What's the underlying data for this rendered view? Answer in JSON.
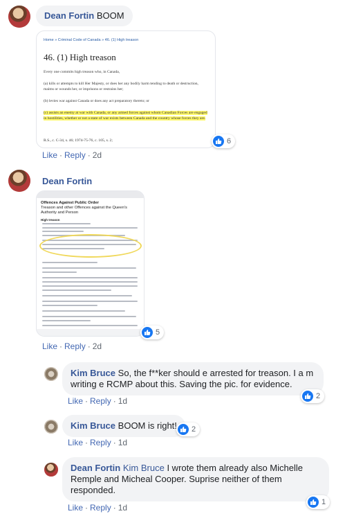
{
  "comments": [
    {
      "author": "Dean Fortin",
      "text": "BOOM",
      "actions": {
        "like": "Like",
        "reply": "Reply",
        "time": "2d"
      },
      "reaction_count": "6",
      "image": {
        "breadcrumb": "Home » Criminal Code of Canada » 46. (1) High treason",
        "heading": "46. (1) High treason",
        "intro": "Every one commits high treason who, in Canada,",
        "a": "(a) kills or attempts to kill Her Majesty, or does her any bodily harm tending to death or destruction, maims or wounds her, or imprisons or restrains her;",
        "b": "(b) levies war against Canada or does any act preparatory thereto; or",
        "c": "(c) assists an enemy at war with Canada, or any armed forces against whom Canadian Forces are engaged in hostilities, whether or not a state of war exists between Canada and the country whose forces they are.",
        "citation": "R.S., c. C-34, s. 46; 1974-75-76, c. 105, s. 2;"
      }
    },
    {
      "author": "Dean Fortin",
      "text": "",
      "actions": {
        "like": "Like",
        "reply": "Reply",
        "time": "2d"
      },
      "reaction_count": "5",
      "image": {
        "title": "Offences Against Public Order",
        "subtitle": "Treason and other Offences against the Queen's Authority and Person",
        "section": "High treason"
      }
    },
    {
      "author": "Kim Bruce",
      "text": "So, the f**ker should e arrested for treason. I a m writing e RCMP about this. Saving the pic. for evidence.",
      "actions": {
        "like": "Like",
        "reply": "Reply",
        "time": "1d"
      },
      "reaction_count": "2"
    },
    {
      "author": "Kim Bruce",
      "text": "BOOM is right!",
      "actions": {
        "like": "Like",
        "reply": "Reply",
        "time": "1d"
      },
      "reaction_count": "2"
    },
    {
      "author": "Dean Fortin",
      "mention": "Kim Bruce",
      "text": "I wrote them already also Michelle Remple and Micheal Cooper. Suprise neither of them responded.",
      "actions": {
        "like": "Like",
        "reply": "Reply",
        "time": "1d"
      },
      "reaction_count": "1"
    }
  ],
  "colors": {
    "link": "#385898",
    "action": "#4267b2",
    "bubble": "#f2f3f5",
    "like": "#1877f2",
    "highlight": "#fff86b"
  },
  "icons": {
    "reaction": "like-icon",
    "avatar": "avatar"
  }
}
